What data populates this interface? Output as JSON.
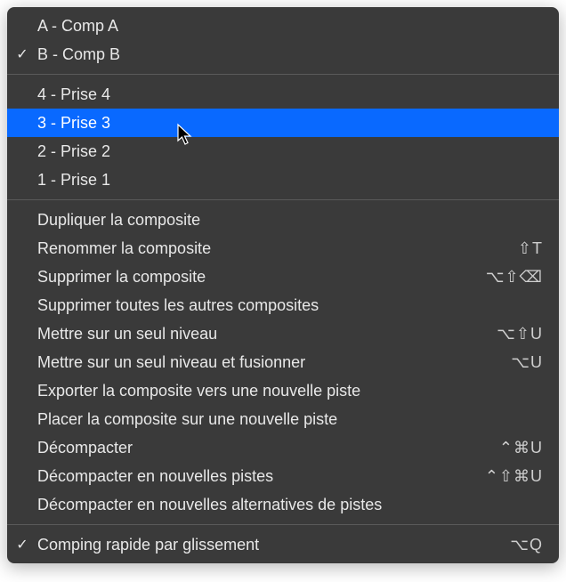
{
  "comps": [
    {
      "label": "A - Comp A",
      "checked": false
    },
    {
      "label": "B - Comp B",
      "checked": true
    }
  ],
  "takes": [
    {
      "label": "4 - Prise 4",
      "highlighted": false
    },
    {
      "label": "3 - Prise 3",
      "highlighted": true
    },
    {
      "label": "2 - Prise 2",
      "highlighted": false
    },
    {
      "label": "1 - Prise 1",
      "highlighted": false
    }
  ],
  "actions": [
    {
      "label": "Dupliquer la composite",
      "shortcut": ""
    },
    {
      "label": "Renommer la composite",
      "shortcut": "⇧T"
    },
    {
      "label": "Supprimer la composite",
      "shortcut": "⌥⇧⌫"
    },
    {
      "label": "Supprimer toutes les autres composites",
      "shortcut": ""
    },
    {
      "label": "Mettre sur un seul niveau",
      "shortcut": "⌥⇧U"
    },
    {
      "label": "Mettre sur un seul niveau et fusionner",
      "shortcut": "⌥U"
    },
    {
      "label": "Exporter la composite vers une nouvelle piste",
      "shortcut": ""
    },
    {
      "label": "Placer la composite sur une nouvelle piste",
      "shortcut": ""
    },
    {
      "label": "Décompacter",
      "shortcut": "⌃⌘U"
    },
    {
      "label": "Décompacter en nouvelles pistes",
      "shortcut": "⌃⇧⌘U"
    },
    {
      "label": "Décompacter en nouvelles alternatives de pistes",
      "shortcut": ""
    }
  ],
  "footer": {
    "label": "Comping rapide par glissement",
    "shortcut": "⌥Q",
    "checked": true
  },
  "glyphs": {
    "check": "✓"
  }
}
